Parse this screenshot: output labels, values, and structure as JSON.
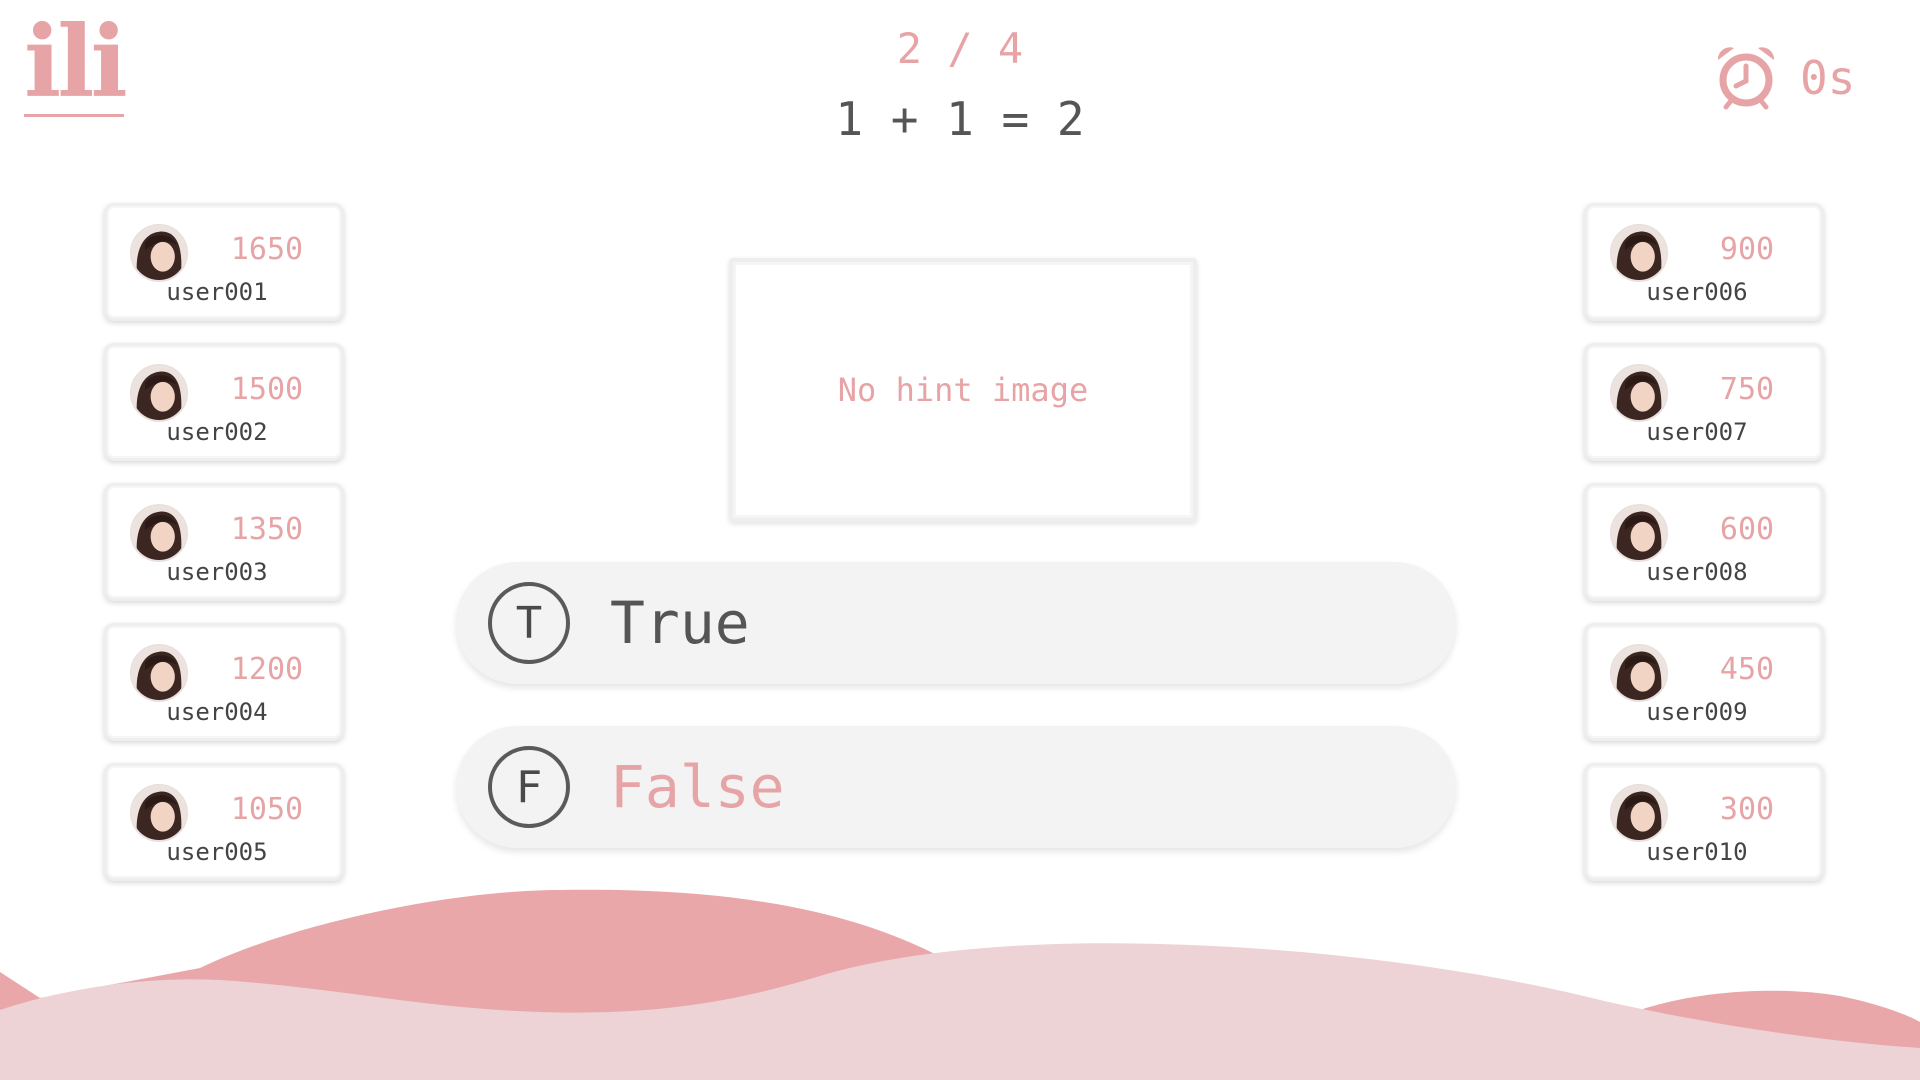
{
  "header": {
    "logo": "ili",
    "progress": "2 / 4",
    "question": "1 + 1 = 2",
    "timer": "0s",
    "timer_icon": "alarm-clock-icon"
  },
  "hint": {
    "text": "No hint image"
  },
  "answers": [
    {
      "letter": "T",
      "label": "True"
    },
    {
      "letter": "F",
      "label": "False"
    }
  ],
  "players_left": [
    {
      "score": "1650",
      "username": "user001"
    },
    {
      "score": "1500",
      "username": "user002"
    },
    {
      "score": "1350",
      "username": "user003"
    },
    {
      "score": "1200",
      "username": "user004"
    },
    {
      "score": "1050",
      "username": "user005"
    }
  ],
  "players_right": [
    {
      "score": "900",
      "username": "user006"
    },
    {
      "score": "750",
      "username": "user007"
    },
    {
      "score": "600",
      "username": "user008"
    },
    {
      "score": "450",
      "username": "user009"
    },
    {
      "score": "300",
      "username": "user010"
    }
  ],
  "colors": {
    "accent": "#e7a4a6",
    "text_dark": "#555555",
    "answer_bg": "#f3f3f3",
    "hill_front": "#edd3d5",
    "hill_back": "#e9a7a9"
  }
}
